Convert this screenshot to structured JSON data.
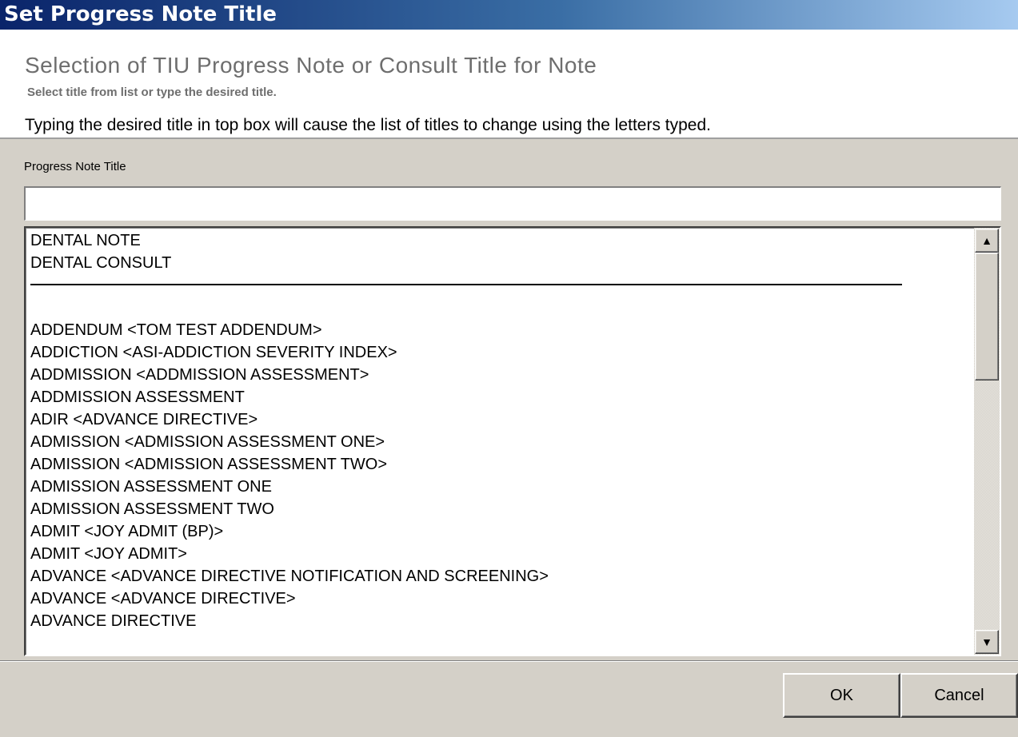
{
  "window": {
    "title": "Set Progress Note Title"
  },
  "header": {
    "title": "Selection of TIU Progress Note or Consult Title for Note",
    "subtitle": "Select title from list or type the desired title.",
    "instruction": "Typing the desired title in top box will cause the list of titles to change using the letters typed."
  },
  "form": {
    "field_label": "Progress Note Title",
    "input_value": "",
    "input_placeholder": ""
  },
  "list": {
    "top_items": [
      "DENTAL NOTE",
      "DENTAL CONSULT"
    ],
    "items": [
      "ADDENDUM  <TOM TEST ADDENDUM>",
      "ADDICTION  <ASI-ADDICTION SEVERITY INDEX>",
      "ADDMISSION  <ADDMISSION ASSESSMENT>",
      "ADDMISSION ASSESSMENT",
      "ADIR  <ADVANCE DIRECTIVE>",
      "ADMISSION  <ADMISSION ASSESSMENT ONE>",
      "ADMISSION  <ADMISSION ASSESSMENT TWO>",
      "ADMISSION ASSESSMENT ONE",
      "ADMISSION ASSESSMENT TWO",
      "ADMIT  <JOY ADMIT (BP)>",
      "ADMIT  <JOY ADMIT>",
      "ADVANCE  <ADVANCE DIRECTIVE NOTIFICATION AND SCREENING>",
      "ADVANCE  <ADVANCE DIRECTIVE>",
      "ADVANCE DIRECTIVE"
    ]
  },
  "scrollbar": {
    "up_icon": "▲",
    "down_icon": "▼"
  },
  "buttons": {
    "ok_label": "OK",
    "cancel_label": "Cancel"
  }
}
